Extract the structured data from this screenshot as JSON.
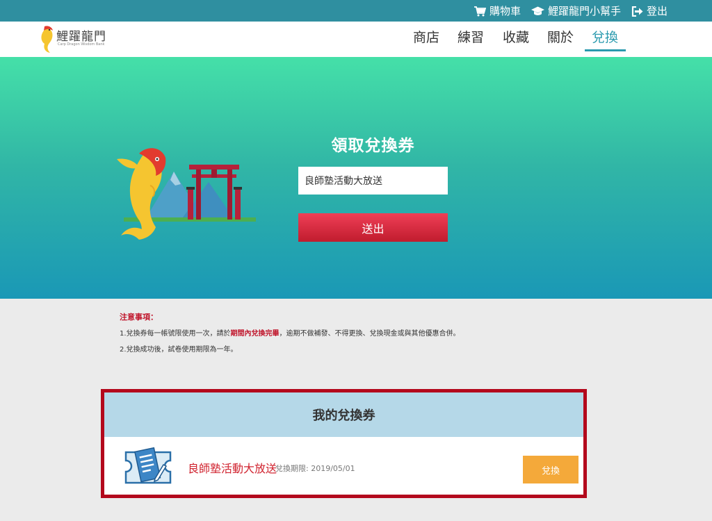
{
  "topbar": {
    "cart_label": "購物車",
    "helper_label": "鯉躍龍門小幫手",
    "logout_label": "登出"
  },
  "brand": {
    "name": "鯉躍龍門",
    "tagline": "Carp Dragon Wisdom Bank"
  },
  "nav": {
    "items": [
      {
        "label": "商店"
      },
      {
        "label": "練習"
      },
      {
        "label": "收藏"
      },
      {
        "label": "關於"
      },
      {
        "label": "兌換",
        "active": true
      }
    ]
  },
  "hero": {
    "title": "領取兌換券",
    "input_value": "良師塾活動大放送",
    "submit_label": "送出"
  },
  "notes": {
    "title": "注意事項：",
    "line1_pre": "1.兌換券每一帳號限使用一次，請於",
    "line1_highlight": "期間內兌換完畢",
    "line1_post": "，逾期不做補發、不得更換、兌換現金或與其他優惠合併。",
    "line2": "2.兌換成功後，試卷使用期限為一年。"
  },
  "my_coupons": {
    "title": "我的兌換券",
    "items": [
      {
        "name": "良師塾活動大放送",
        "expiry": "兌換期限: 2019/05/01",
        "redeem_label": "兌換"
      }
    ]
  },
  "colors": {
    "topbar_bg": "#2f8fa0",
    "accent": "#2a9aae",
    "submit_red": "#c01c2e",
    "highlight_red": "#c0152b",
    "panel_border": "#b3081c",
    "panel_head": "#b5d8e8",
    "redeem_orange": "#f4a93a"
  },
  "icons": [
    "cart-icon",
    "graduation-cap-icon",
    "logout-icon",
    "carp-logo-icon",
    "carp-gate-illustration",
    "document-pen-icon"
  ]
}
